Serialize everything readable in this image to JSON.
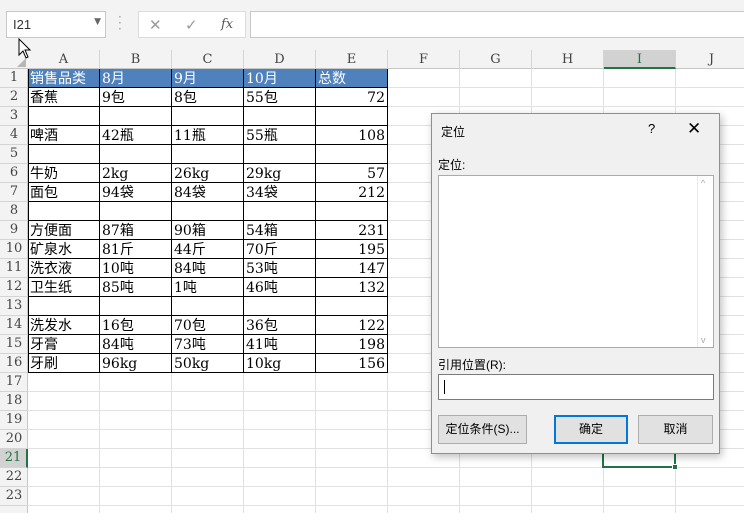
{
  "name_box": {
    "value": "I21"
  },
  "formula_bar": {
    "cancel_glyph": "✕",
    "enter_glyph": "✓",
    "fx_glyph": "fx",
    "value": ""
  },
  "columns": [
    "A",
    "B",
    "C",
    "D",
    "E",
    "F",
    "G",
    "H",
    "I",
    "J"
  ],
  "rows": [
    "1",
    "2",
    "3",
    "4",
    "5",
    "6",
    "7",
    "8",
    "9",
    "10",
    "11",
    "12",
    "13",
    "14",
    "15",
    "16",
    "17",
    "18",
    "19",
    "20",
    "21",
    "22",
    "23"
  ],
  "active_cell": {
    "column": "I",
    "row": "21"
  },
  "sheet": {
    "header": [
      "销售品类",
      "8月",
      "9月",
      "10月",
      "总数"
    ],
    "data": [
      {
        "row": 2,
        "cells": [
          "香蕉",
          "9包",
          "8包",
          "55包",
          "72"
        ]
      },
      {
        "row": 4,
        "cells": [
          "啤酒",
          "42瓶",
          "11瓶",
          "55瓶",
          "108"
        ]
      },
      {
        "row": 6,
        "cells": [
          "牛奶",
          "2kg",
          "26kg",
          "29kg",
          "57"
        ]
      },
      {
        "row": 7,
        "cells": [
          "面包",
          "94袋",
          "84袋",
          "34袋",
          "212"
        ]
      },
      {
        "row": 9,
        "cells": [
          "方便面",
          "87箱",
          "90箱",
          "54箱",
          "231"
        ]
      },
      {
        "row": 10,
        "cells": [
          "矿泉水",
          "81斤",
          "44斤",
          "70斤",
          "195"
        ]
      },
      {
        "row": 11,
        "cells": [
          "洗衣液",
          "10吨",
          "84吨",
          "53吨",
          "147"
        ]
      },
      {
        "row": 12,
        "cells": [
          "卫生纸",
          "85吨",
          "1吨",
          "46吨",
          "132"
        ]
      },
      {
        "row": 14,
        "cells": [
          "洗发水",
          "16包",
          "70包",
          "36包",
          "122"
        ]
      },
      {
        "row": 15,
        "cells": [
          "牙膏",
          "84吨",
          "73吨",
          "41吨",
          "198"
        ]
      },
      {
        "row": 16,
        "cells": [
          "牙刷",
          "96kg",
          "50kg",
          "10kg",
          "156"
        ]
      }
    ]
  },
  "dialog": {
    "title": "定位",
    "help": "?",
    "close": "✕",
    "goto_label": "定位:",
    "reference_label": "引用位置(R):",
    "reference_value": "",
    "special_button": "定位条件(S)...",
    "ok_button": "确定",
    "cancel_button": "取消"
  },
  "colors": {
    "header_fill": "#4f81bd",
    "selection": "#217346",
    "default_button_border": "#0078d7"
  }
}
